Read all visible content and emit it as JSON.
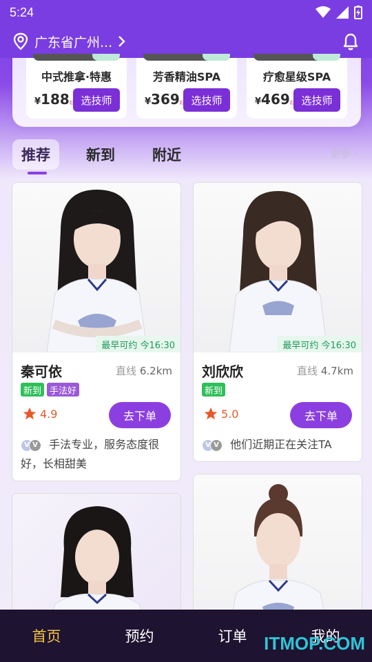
{
  "status_bar": {
    "time": "5:24"
  },
  "header": {
    "location": "广东省广州..."
  },
  "services": [
    {
      "name": "中式推拿·特惠",
      "currency": "¥",
      "price": "188",
      "unit": "起",
      "button": "选技师"
    },
    {
      "name": "芳香精油SPA",
      "currency": "¥",
      "price": "369",
      "unit": "起",
      "button": "选技师"
    },
    {
      "name": "疗愈星级SPA",
      "currency": "¥",
      "price": "469",
      "unit": "起",
      "button": "选技师"
    }
  ],
  "tabs": [
    {
      "label": "推荐",
      "active": true
    },
    {
      "label": "新到"
    },
    {
      "label": "附近"
    }
  ],
  "more_label": "更多",
  "therapists": [
    {
      "name": "秦可依",
      "distance_label": "直线",
      "distance": "6.2km",
      "tags": [
        "新到",
        "手法好"
      ],
      "rating": "4.9",
      "earliest": "最早可约 今16:30",
      "button": "去下单",
      "comment": "手法专业，服务态度很好，长相甜美"
    },
    {
      "name": "刘欣欣",
      "distance_label": "直线",
      "distance": "4.7km",
      "tags": [
        "新到"
      ],
      "rating": "5.0",
      "earliest": "最早可约 今16:30",
      "button": "去下单",
      "comment": "他们近期正在关注TA"
    }
  ],
  "bottom_nav": [
    {
      "label": "首页",
      "active": true
    },
    {
      "label": "预约"
    },
    {
      "label": "订单"
    },
    {
      "label": "我的"
    }
  ],
  "watermark": "ITMOP.COM",
  "colors": {
    "primary": "#7a3de2",
    "accent": "#8c3fe0",
    "nav_bg": "#1e1330",
    "nav_active": "#f6c443"
  }
}
